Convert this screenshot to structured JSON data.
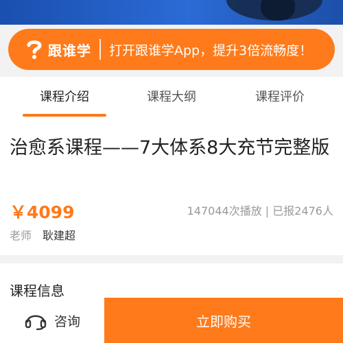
{
  "banner": {
    "brand_name": "跟谁学",
    "text": "打开跟谁学App，提升3倍流畅度！"
  },
  "tabs": [
    {
      "label": "课程介绍",
      "active": true
    },
    {
      "label": "课程大纲",
      "active": false
    },
    {
      "label": "课程评价",
      "active": false
    }
  ],
  "course": {
    "title": "治愈系课程——7大体系8大充节完整版",
    "price": "￥4099",
    "stats": "147044次播放 | 已报2476人",
    "teacher_label": "老师",
    "teacher_name": "耿建超"
  },
  "info": {
    "title": "课程信息"
  },
  "bottom_bar": {
    "consult_label": "咨询",
    "buy_label": "立即购买"
  },
  "colors": {
    "accent": "#ff7a1a",
    "hero": "#1f57b8"
  }
}
